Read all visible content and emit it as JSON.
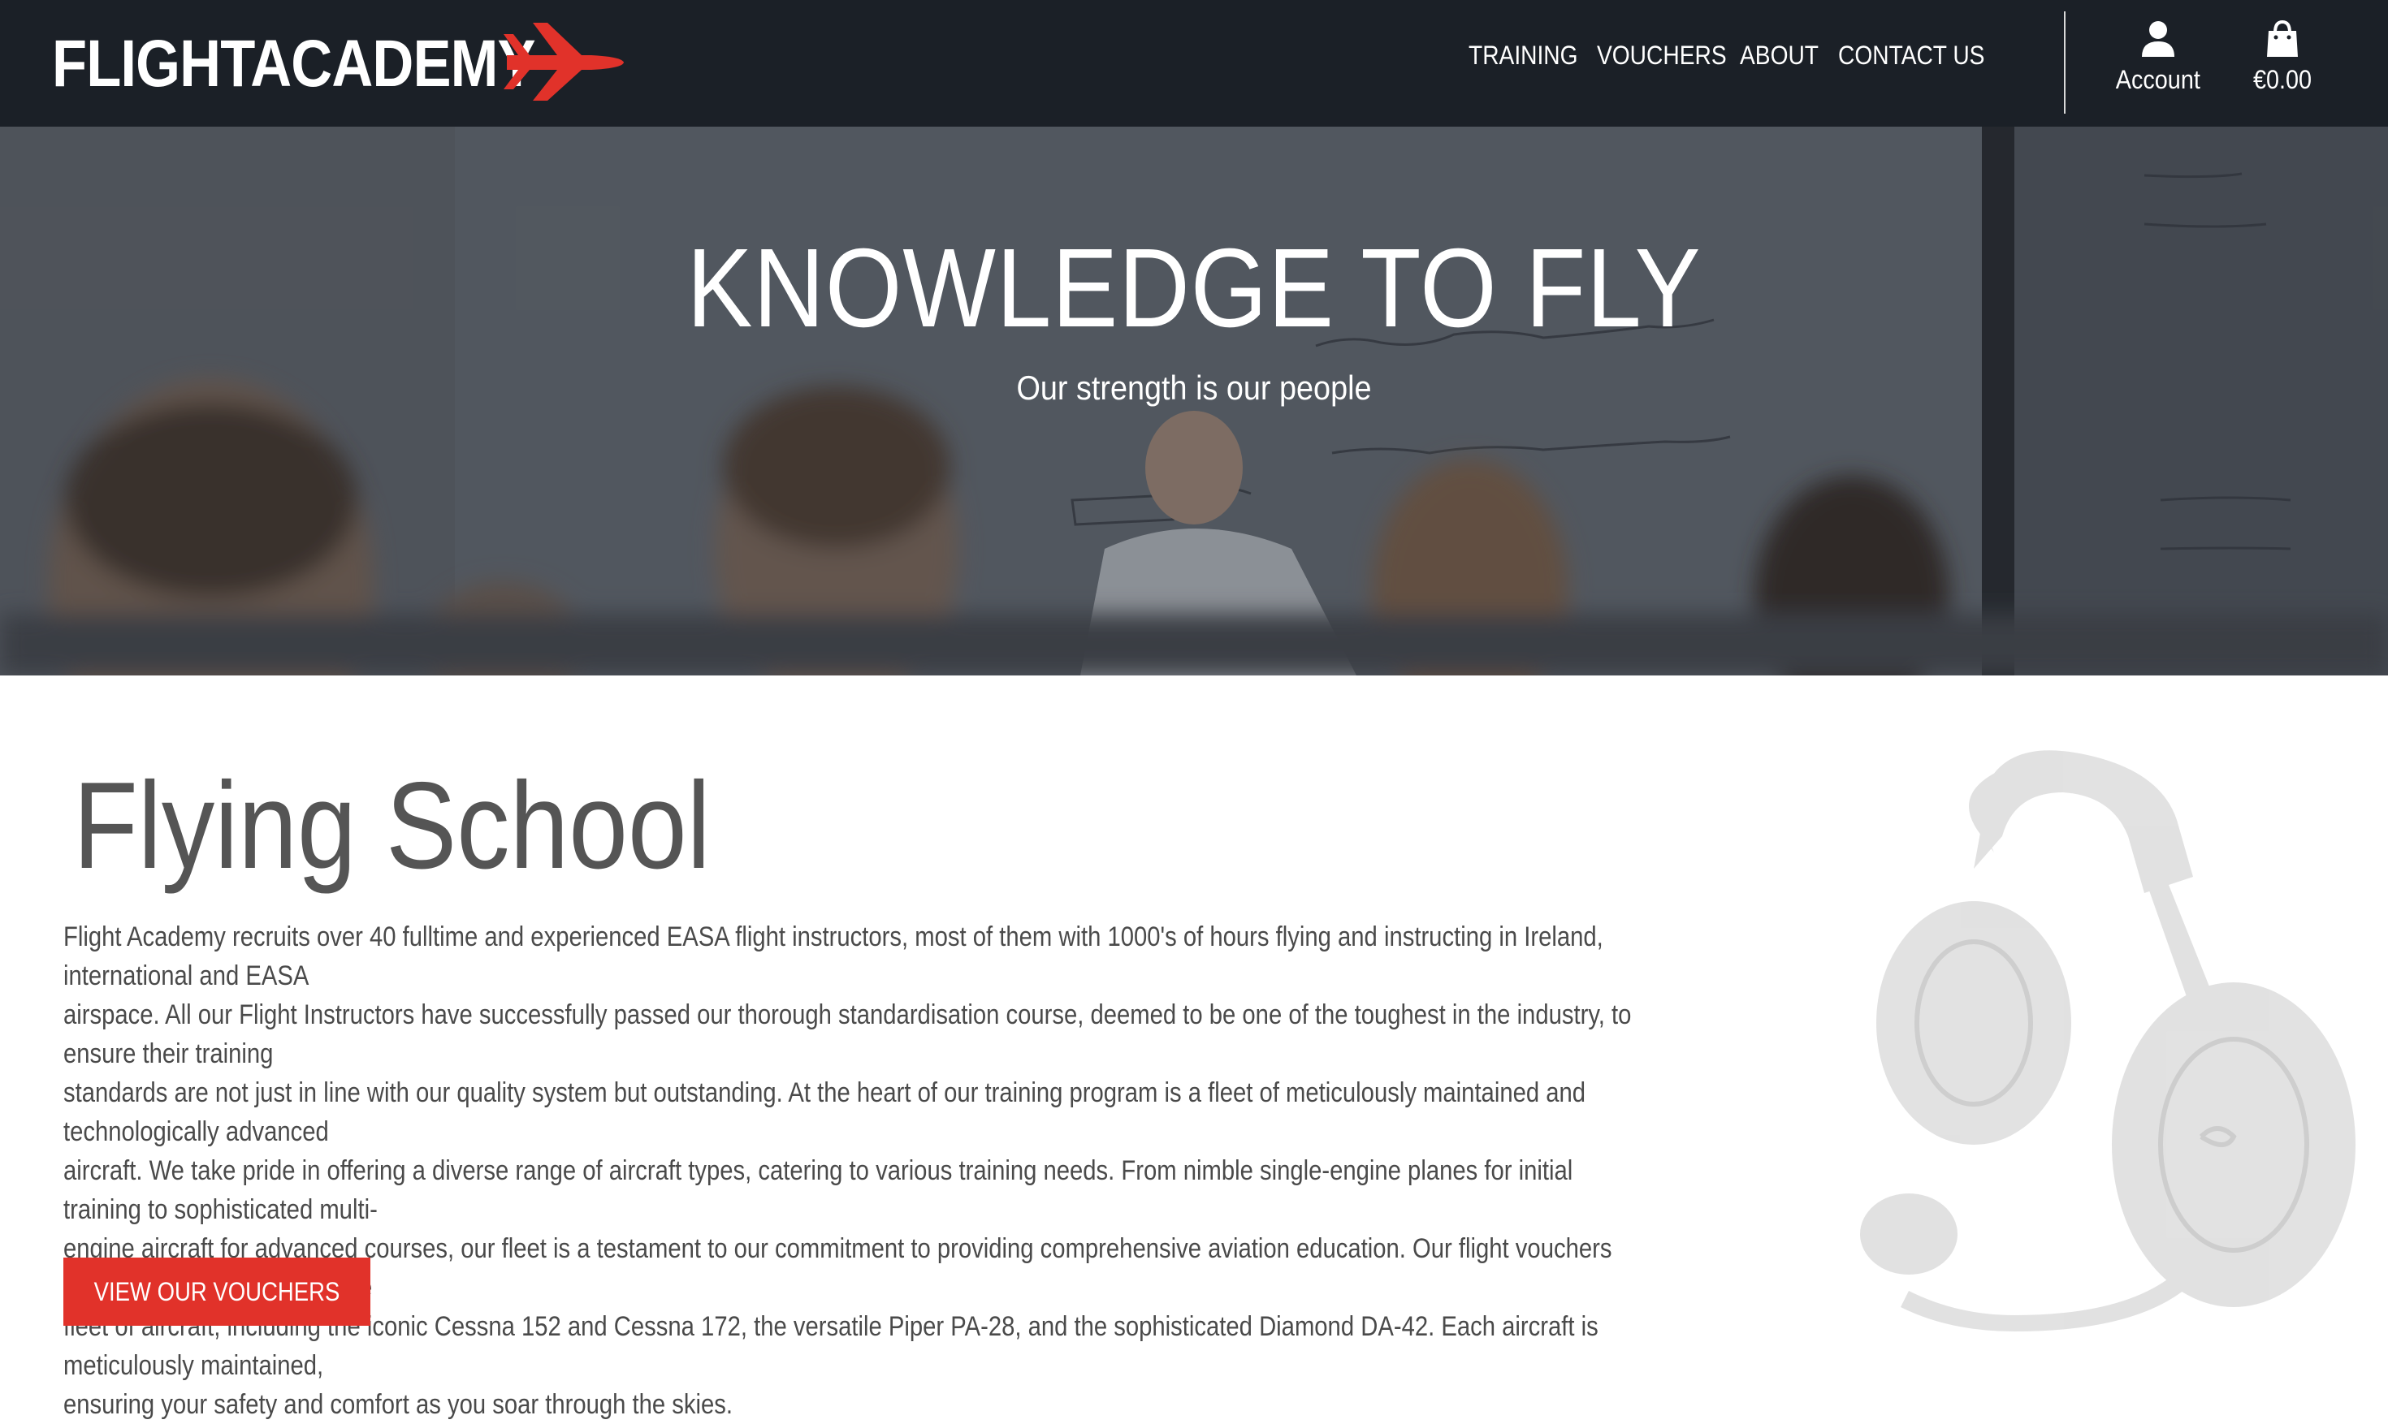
{
  "header": {
    "logo_text": "FLIGHTACADEMY",
    "nav": [
      "TRAINING",
      "VOUCHERS",
      "ABOUT",
      "CONTACT US"
    ],
    "account_label": "Account",
    "cart_total": "€0.00"
  },
  "hero": {
    "title": "KNOWLEDGE TO FLY",
    "subtitle": "Our strength is our people"
  },
  "main": {
    "heading": "Flying School",
    "body_lines": [
      "Flight Academy recruits over 40 fulltime and experienced EASA flight instructors, most of them with 1000's of hours flying and instructing in Ireland, international and EASA",
      "airspace. All our Flight Instructors have successfully passed our thorough standardisation course, deemed to be one of the toughest in the industry, to ensure their training",
      "standards are not just in line with our quality system but outstanding. At the heart of our training program is a fleet of meticulously maintained and technologically advanced",
      "aircraft. We take pride in offering a diverse range of aircraft types, catering to various training needs. From nimble single-engine planes for initial training to sophisticated multi-",
      "engine aircraft for advanced courses, our fleet is a testament to our commitment to providing comprehensive aviation education. Our flight vouchers grant you access to a diverse",
      "fleet of aircraft, including the iconic Cessna 152 and Cessna 172, the versatile Piper PA-28, and the sophisticated Diamond DA-42. Each aircraft is meticulously maintained,",
      "ensuring your safety and comfort as you soar through the skies."
    ],
    "cta_label": "VIEW OUR VOUCHERS"
  },
  "colors": {
    "header_bg": "#1b2027",
    "accent": "#e1322a",
    "heading": "#555555",
    "body_text": "#4a4a4a"
  },
  "icons": {
    "logo": "plane-icon",
    "account": "user-icon",
    "cart": "shopping-bag-icon"
  }
}
